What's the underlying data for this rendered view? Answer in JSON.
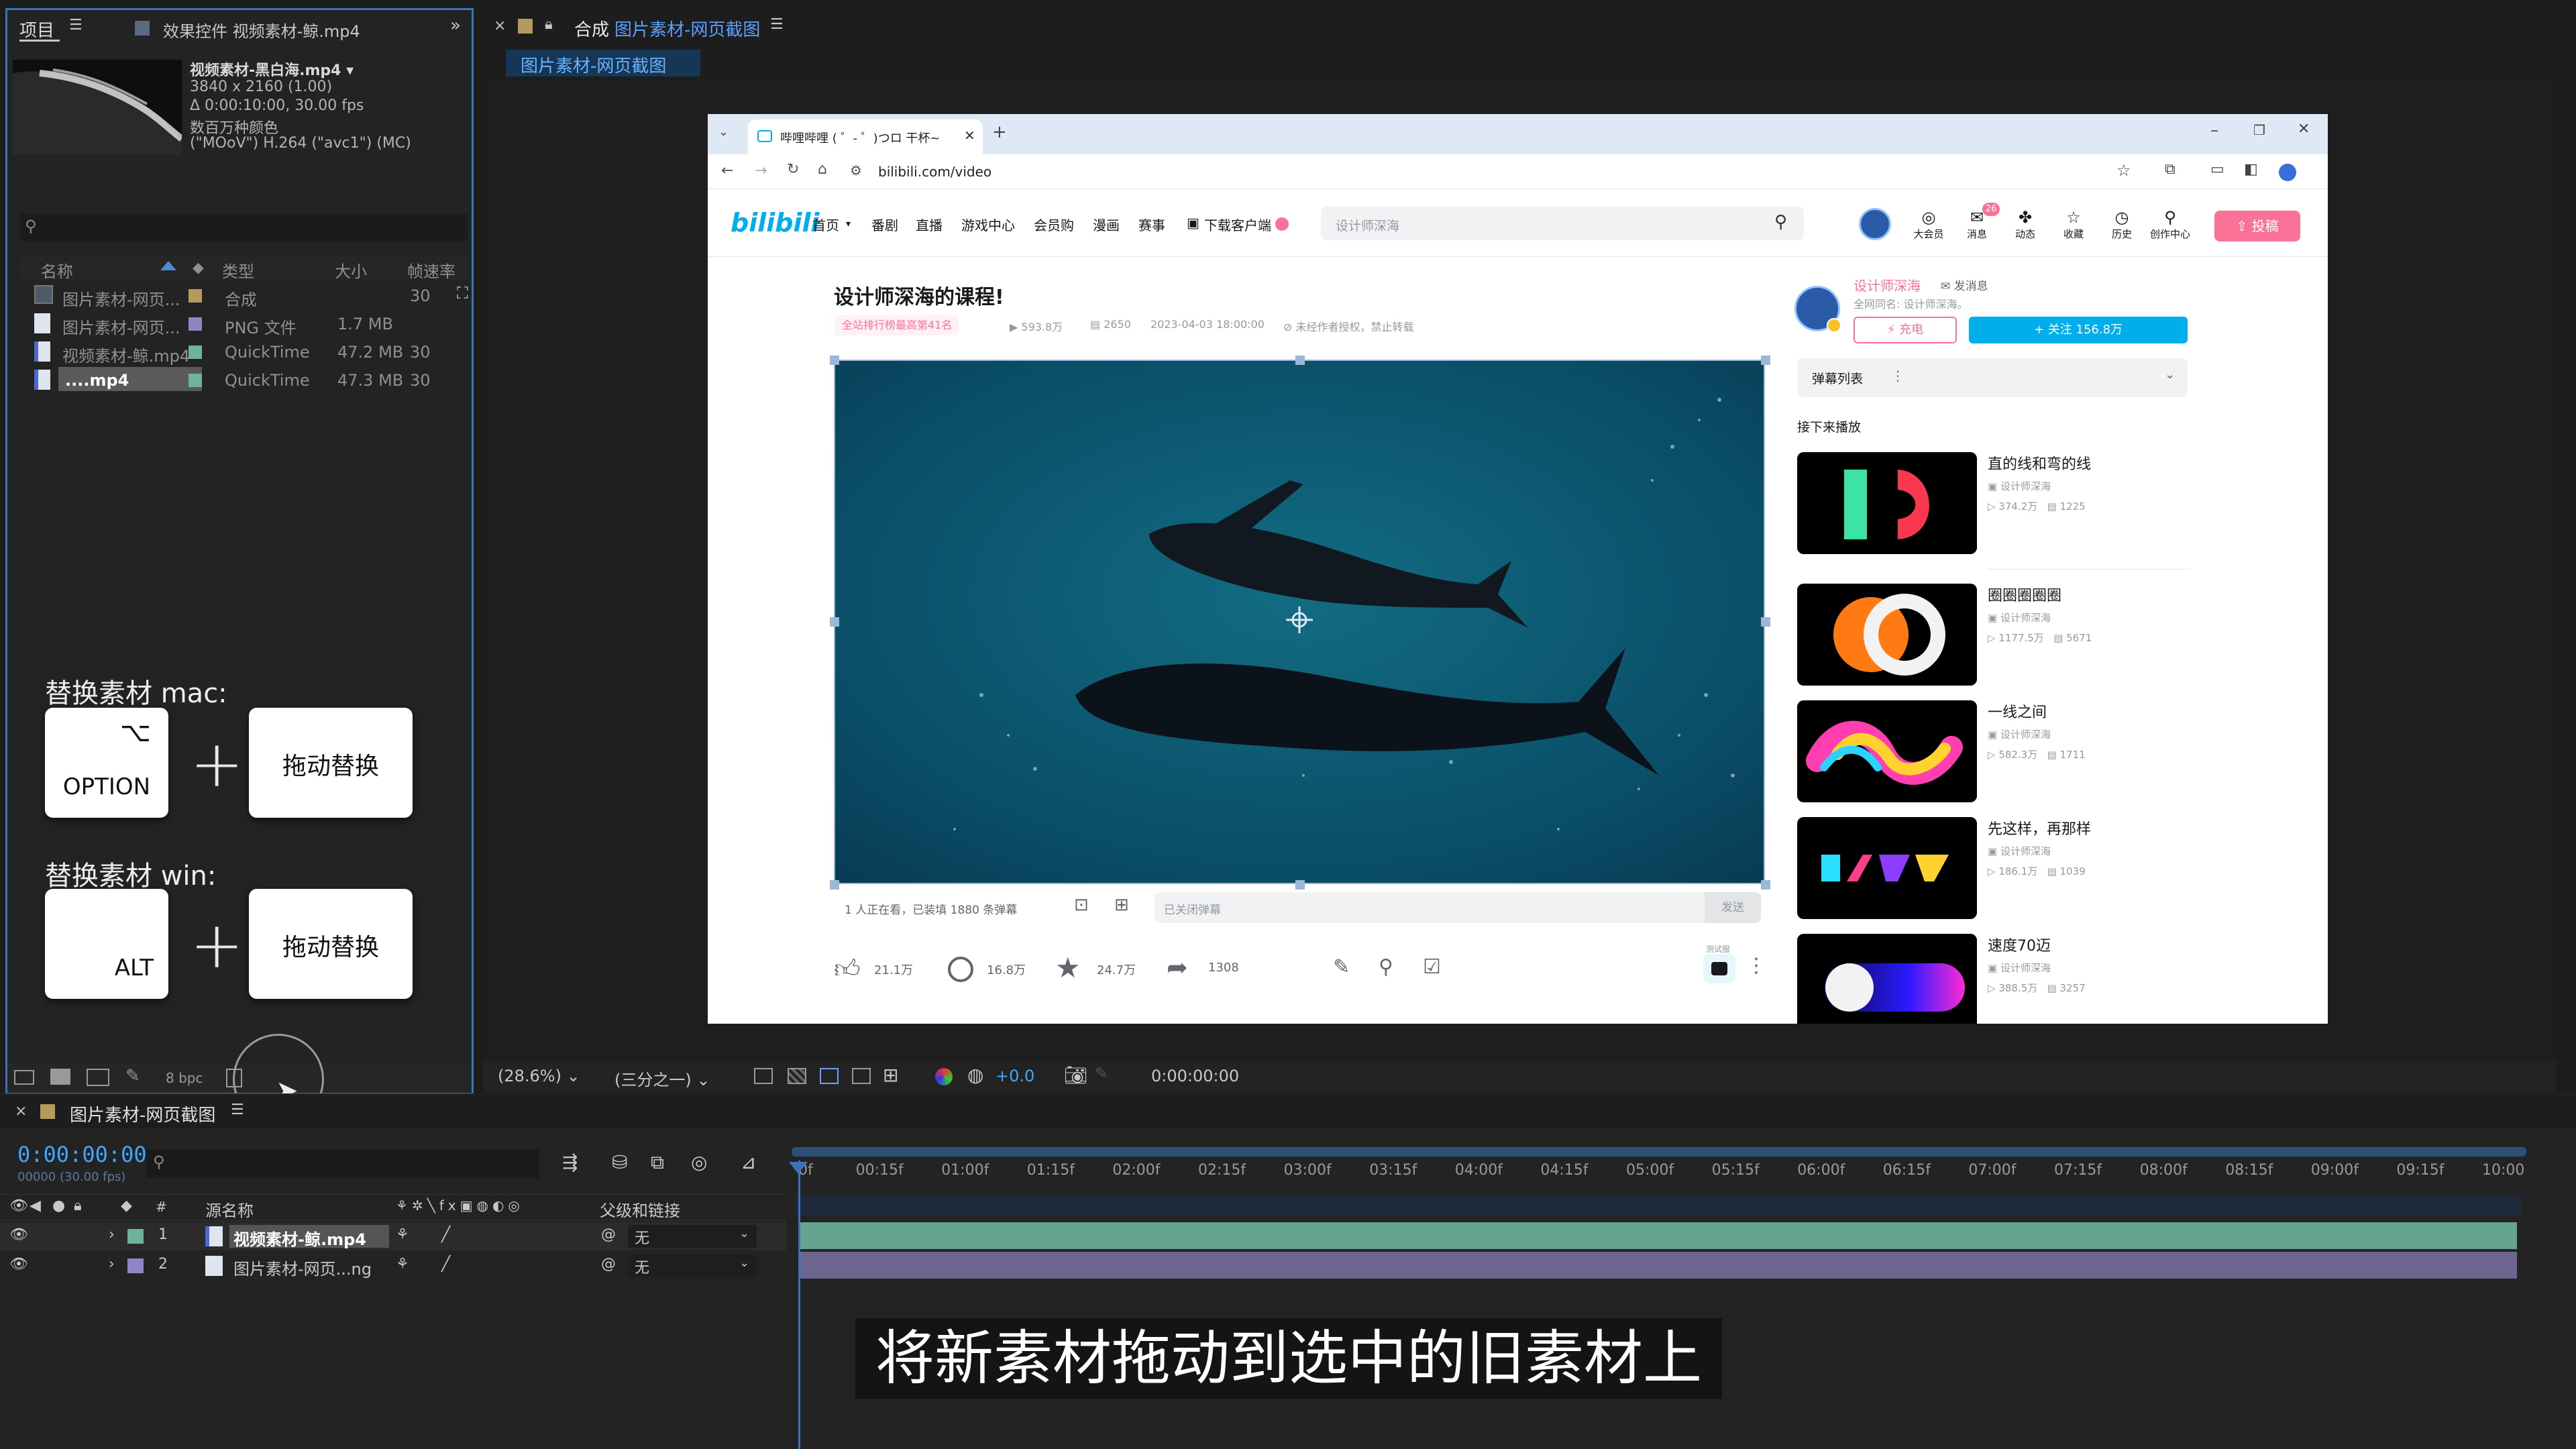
{
  "colors": {
    "accent": "#3d73b8",
    "bilibili_pink": "#fb7299",
    "bilibili_blue": "#00aeec",
    "green_layer": "#6fb39a",
    "lavender_layer": "#8d86c4",
    "timecode": "#3fa7ff"
  },
  "project": {
    "tab_project": "项目",
    "tab_effects": "效果控件 视频素材-鲸.mp4",
    "more": "»",
    "item_name": "视频素材-黑白海.mp4 ▾",
    "item_res": "3840 x 2160 (1.00)",
    "item_dur": "Δ 0:00:10:00, 30.00 fps",
    "item_color": "数百万种颜色",
    "item_codec": "(\"MOoV\") H.264 (\"avc1\") (MC)",
    "columns": {
      "name": "名称",
      "type": "类型",
      "size": "大小",
      "fps": "帧速率"
    },
    "rows": [
      {
        "name": "图片素材-网页...",
        "type": "合成",
        "size": "",
        "fps": "30"
      },
      {
        "name": "图片素材-网页...",
        "type": "PNG 文件",
        "size": "1.7 MB",
        "fps": ""
      },
      {
        "name": "视频素材-鲸.mp4",
        "type": "QuickTime",
        "size": "47.2 MB",
        "fps": "30"
      },
      {
        "name": "....mp4",
        "type": "QuickTime",
        "size": "47.3 MB",
        "fps": "30"
      }
    ],
    "bpc": "8 bpc"
  },
  "overlay": {
    "mac_title": "替换素材 mac:",
    "mac_symbol": "⌥",
    "mac_key": "OPTION",
    "drag": "拖动替换",
    "plus": "+",
    "win_title": "替换素材 win:",
    "win_key": "ALT"
  },
  "comp": {
    "tab_prefix": "合成",
    "tab_name": "图片素材-网页截图",
    "sub_tab": "图片素材-网页截图",
    "zoom": "(28.6%)",
    "resolution": "(三分之一)",
    "exposure": "+0.0",
    "time": "0:00:00:00"
  },
  "browser": {
    "tab_title": "哔哩哔哩 ( ゜- ゜)つロ 干杯~",
    "url": "bilibili.com/video",
    "logo": "bilibili",
    "nav": [
      "首页",
      "番剧",
      "直播",
      "游戏中心",
      "会员购",
      "漫画",
      "赛事",
      "下载客户端"
    ],
    "search_placeholder": "设计师深海",
    "right_icons": [
      "大会员",
      "消息",
      "动态",
      "收藏",
      "历史",
      "创作中心"
    ],
    "msg_badge": "26",
    "upload": "投稿",
    "video_title": "设计师深海的课程!",
    "rank": "全站排行榜最高第41名",
    "views": "593.8万",
    "danmaku": "2650",
    "date": "2023-04-03 18:00:00",
    "copyright": "未经作者授权，禁止转载",
    "watching": "1 人正在看，已装填 1880 条弹幕",
    "danmaku_input": "已关闭弹幕",
    "send": "发送",
    "likes": "21.1万",
    "coins": "16.8万",
    "favs": "24.7万",
    "shares": "1308",
    "test_label": "测试服",
    "author": "设计师深海",
    "message": "发消息",
    "author_sub": "全网同名: 设计师深海。",
    "charge": "充电",
    "follow": "+ 关注 156.8万",
    "danmaku_list": "弹幕列表",
    "next_up": "接下来播放",
    "recs": [
      {
        "title": "直的线和弯的线",
        "author": "设计师深海",
        "views": "374.2万",
        "dm": "1225"
      },
      {
        "title": "圈圈圈圈圈",
        "author": "设计师深海",
        "views": "1177.5万",
        "dm": "5671"
      },
      {
        "title": "一线之间",
        "author": "设计师深海",
        "views": "582.3万",
        "dm": "1711"
      },
      {
        "title": "先这样，再那样",
        "author": "设计师深海",
        "views": "186.1万",
        "dm": "1039"
      },
      {
        "title": "速度70迈",
        "author": "设计师深海",
        "views": "388.5万",
        "dm": "3257"
      }
    ]
  },
  "timeline": {
    "tab": "图片素材-网页截图",
    "timecode": "0:00:00:00",
    "frames": "00000 (30.00 fps)",
    "col_source": "源名称",
    "col_parent": "父级和链接",
    "ruler": [
      "0f",
      "00:15f",
      "01:00f",
      "01:15f",
      "02:00f",
      "02:15f",
      "03:00f",
      "03:15f",
      "04:00f",
      "04:15f",
      "05:00f",
      "05:15f",
      "06:00f",
      "06:15f",
      "07:00f",
      "07:15f",
      "08:00f",
      "08:15f",
      "09:00f",
      "09:15f",
      "10:00"
    ],
    "layers": [
      {
        "num": "1",
        "name": "视频素材-鲸.mp4",
        "parent": "无"
      },
      {
        "num": "2",
        "name": "图片素材-网页...ng",
        "parent": "无"
      }
    ]
  },
  "subtitle": "将新素材拖动到选中的旧素材上"
}
